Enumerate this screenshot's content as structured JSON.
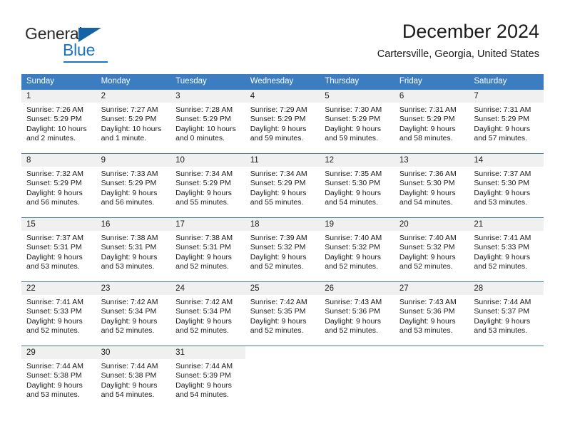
{
  "brand": {
    "name_part1": "General",
    "name_part2": "Blue",
    "accent_color": "#1d73bd",
    "triangle_color": "#1464a5"
  },
  "header": {
    "title": "December 2024",
    "subtitle": "Cartersville, Georgia, United States",
    "header_bg_color": "#3b7dc0",
    "day_band_color": "#f0f0f0"
  },
  "weekdays": [
    {
      "label": "Sunday"
    },
    {
      "label": "Monday"
    },
    {
      "label": "Tuesday"
    },
    {
      "label": "Wednesday"
    },
    {
      "label": "Thursday"
    },
    {
      "label": "Friday"
    },
    {
      "label": "Saturday"
    }
  ],
  "weeks": [
    [
      {
        "day": "1",
        "line1": "Sunrise: 7:26 AM",
        "line2": "Sunset: 5:29 PM",
        "line3": "Daylight: 10 hours",
        "line4": "and 2 minutes."
      },
      {
        "day": "2",
        "line1": "Sunrise: 7:27 AM",
        "line2": "Sunset: 5:29 PM",
        "line3": "Daylight: 10 hours",
        "line4": "and 1 minute."
      },
      {
        "day": "3",
        "line1": "Sunrise: 7:28 AM",
        "line2": "Sunset: 5:29 PM",
        "line3": "Daylight: 10 hours",
        "line4": "and 0 minutes."
      },
      {
        "day": "4",
        "line1": "Sunrise: 7:29 AM",
        "line2": "Sunset: 5:29 PM",
        "line3": "Daylight: 9 hours",
        "line4": "and 59 minutes."
      },
      {
        "day": "5",
        "line1": "Sunrise: 7:30 AM",
        "line2": "Sunset: 5:29 PM",
        "line3": "Daylight: 9 hours",
        "line4": "and 59 minutes."
      },
      {
        "day": "6",
        "line1": "Sunrise: 7:31 AM",
        "line2": "Sunset: 5:29 PM",
        "line3": "Daylight: 9 hours",
        "line4": "and 58 minutes."
      },
      {
        "day": "7",
        "line1": "Sunrise: 7:31 AM",
        "line2": "Sunset: 5:29 PM",
        "line3": "Daylight: 9 hours",
        "line4": "and 57 minutes."
      }
    ],
    [
      {
        "day": "8",
        "line1": "Sunrise: 7:32 AM",
        "line2": "Sunset: 5:29 PM",
        "line3": "Daylight: 9 hours",
        "line4": "and 56 minutes."
      },
      {
        "day": "9",
        "line1": "Sunrise: 7:33 AM",
        "line2": "Sunset: 5:29 PM",
        "line3": "Daylight: 9 hours",
        "line4": "and 56 minutes."
      },
      {
        "day": "10",
        "line1": "Sunrise: 7:34 AM",
        "line2": "Sunset: 5:29 PM",
        "line3": "Daylight: 9 hours",
        "line4": "and 55 minutes."
      },
      {
        "day": "11",
        "line1": "Sunrise: 7:34 AM",
        "line2": "Sunset: 5:29 PM",
        "line3": "Daylight: 9 hours",
        "line4": "and 55 minutes."
      },
      {
        "day": "12",
        "line1": "Sunrise: 7:35 AM",
        "line2": "Sunset: 5:30 PM",
        "line3": "Daylight: 9 hours",
        "line4": "and 54 minutes."
      },
      {
        "day": "13",
        "line1": "Sunrise: 7:36 AM",
        "line2": "Sunset: 5:30 PM",
        "line3": "Daylight: 9 hours",
        "line4": "and 54 minutes."
      },
      {
        "day": "14",
        "line1": "Sunrise: 7:37 AM",
        "line2": "Sunset: 5:30 PM",
        "line3": "Daylight: 9 hours",
        "line4": "and 53 minutes."
      }
    ],
    [
      {
        "day": "15",
        "line1": "Sunrise: 7:37 AM",
        "line2": "Sunset: 5:31 PM",
        "line3": "Daylight: 9 hours",
        "line4": "and 53 minutes."
      },
      {
        "day": "16",
        "line1": "Sunrise: 7:38 AM",
        "line2": "Sunset: 5:31 PM",
        "line3": "Daylight: 9 hours",
        "line4": "and 53 minutes."
      },
      {
        "day": "17",
        "line1": "Sunrise: 7:38 AM",
        "line2": "Sunset: 5:31 PM",
        "line3": "Daylight: 9 hours",
        "line4": "and 52 minutes."
      },
      {
        "day": "18",
        "line1": "Sunrise: 7:39 AM",
        "line2": "Sunset: 5:32 PM",
        "line3": "Daylight: 9 hours",
        "line4": "and 52 minutes."
      },
      {
        "day": "19",
        "line1": "Sunrise: 7:40 AM",
        "line2": "Sunset: 5:32 PM",
        "line3": "Daylight: 9 hours",
        "line4": "and 52 minutes."
      },
      {
        "day": "20",
        "line1": "Sunrise: 7:40 AM",
        "line2": "Sunset: 5:32 PM",
        "line3": "Daylight: 9 hours",
        "line4": "and 52 minutes."
      },
      {
        "day": "21",
        "line1": "Sunrise: 7:41 AM",
        "line2": "Sunset: 5:33 PM",
        "line3": "Daylight: 9 hours",
        "line4": "and 52 minutes."
      }
    ],
    [
      {
        "day": "22",
        "line1": "Sunrise: 7:41 AM",
        "line2": "Sunset: 5:33 PM",
        "line3": "Daylight: 9 hours",
        "line4": "and 52 minutes."
      },
      {
        "day": "23",
        "line1": "Sunrise: 7:42 AM",
        "line2": "Sunset: 5:34 PM",
        "line3": "Daylight: 9 hours",
        "line4": "and 52 minutes."
      },
      {
        "day": "24",
        "line1": "Sunrise: 7:42 AM",
        "line2": "Sunset: 5:34 PM",
        "line3": "Daylight: 9 hours",
        "line4": "and 52 minutes."
      },
      {
        "day": "25",
        "line1": "Sunrise: 7:42 AM",
        "line2": "Sunset: 5:35 PM",
        "line3": "Daylight: 9 hours",
        "line4": "and 52 minutes."
      },
      {
        "day": "26",
        "line1": "Sunrise: 7:43 AM",
        "line2": "Sunset: 5:36 PM",
        "line3": "Daylight: 9 hours",
        "line4": "and 52 minutes."
      },
      {
        "day": "27",
        "line1": "Sunrise: 7:43 AM",
        "line2": "Sunset: 5:36 PM",
        "line3": "Daylight: 9 hours",
        "line4": "and 53 minutes."
      },
      {
        "day": "28",
        "line1": "Sunrise: 7:44 AM",
        "line2": "Sunset: 5:37 PM",
        "line3": "Daylight: 9 hours",
        "line4": "and 53 minutes."
      }
    ],
    [
      {
        "day": "29",
        "line1": "Sunrise: 7:44 AM",
        "line2": "Sunset: 5:38 PM",
        "line3": "Daylight: 9 hours",
        "line4": "and 53 minutes."
      },
      {
        "day": "30",
        "line1": "Sunrise: 7:44 AM",
        "line2": "Sunset: 5:38 PM",
        "line3": "Daylight: 9 hours",
        "line4": "and 54 minutes."
      },
      {
        "day": "31",
        "line1": "Sunrise: 7:44 AM",
        "line2": "Sunset: 5:39 PM",
        "line3": "Daylight: 9 hours",
        "line4": "and 54 minutes."
      },
      {
        "day": "",
        "line1": "",
        "line2": "",
        "line3": "",
        "line4": ""
      },
      {
        "day": "",
        "line1": "",
        "line2": "",
        "line3": "",
        "line4": ""
      },
      {
        "day": "",
        "line1": "",
        "line2": "",
        "line3": "",
        "line4": ""
      },
      {
        "day": "",
        "line1": "",
        "line2": "",
        "line3": "",
        "line4": ""
      }
    ]
  ]
}
